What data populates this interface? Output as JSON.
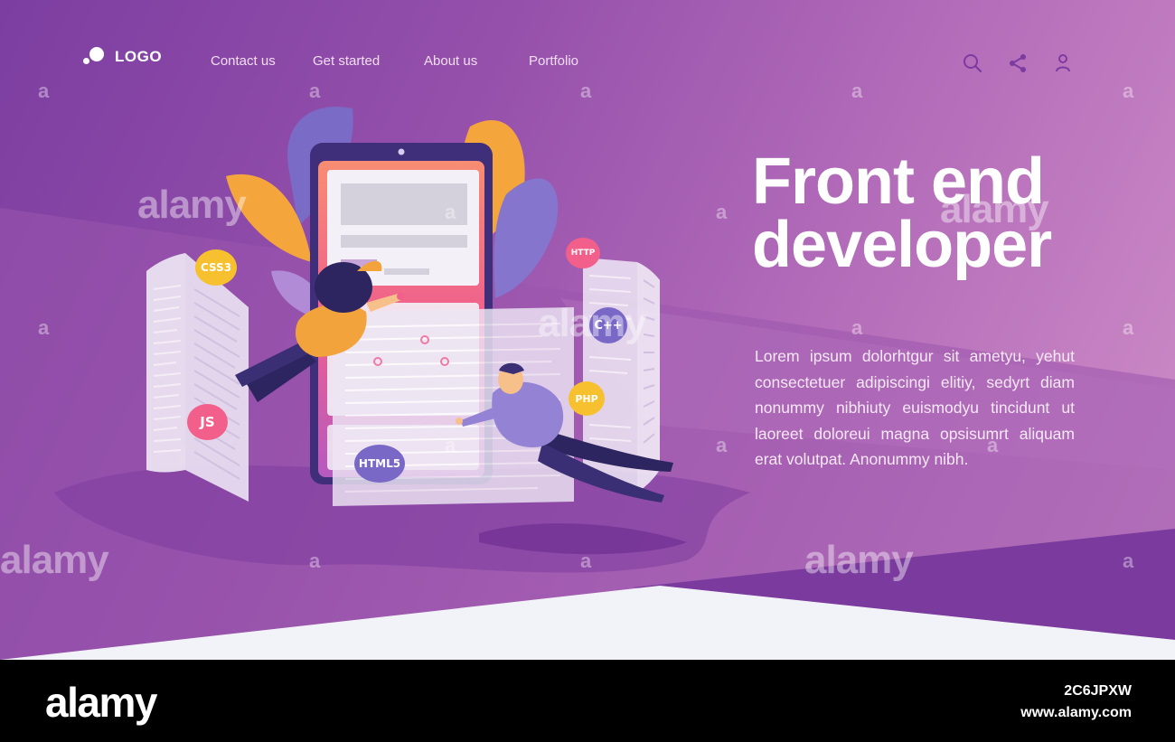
{
  "header": {
    "logo_text": "LOGO",
    "nav": [
      "Contact us",
      "Get started",
      "About us",
      "Portfolio"
    ],
    "icons": [
      "search-icon",
      "share-icon",
      "user-icon"
    ]
  },
  "hero": {
    "title_line1": "Front end",
    "title_line2": "developer",
    "body": "Lorem ipsum dolorhtgur sit ametyu, yehut consectetuer adipiscingi elitiy, sedyrt diam nonummy nibhiuty euismodyu tincidunt ut laoreet doloreui magna opsisumrt aliquam erat volutpat. Anonummy nibh."
  },
  "illustration": {
    "badges": [
      "CSS3",
      "HTTP",
      "C++",
      "PHP",
      "JS",
      "HTML5"
    ]
  },
  "watermark": {
    "brand": "alamy",
    "letter": "a"
  },
  "footer": {
    "brand": "alamy",
    "image_id": "2C6JPXW",
    "url": "www.alamy.com"
  },
  "colors": {
    "accent_purple": "#7c3ea1",
    "pink": "#f15f8a",
    "orange": "#f7a53a",
    "yellow": "#f7c02f",
    "violet": "#7968c6"
  }
}
